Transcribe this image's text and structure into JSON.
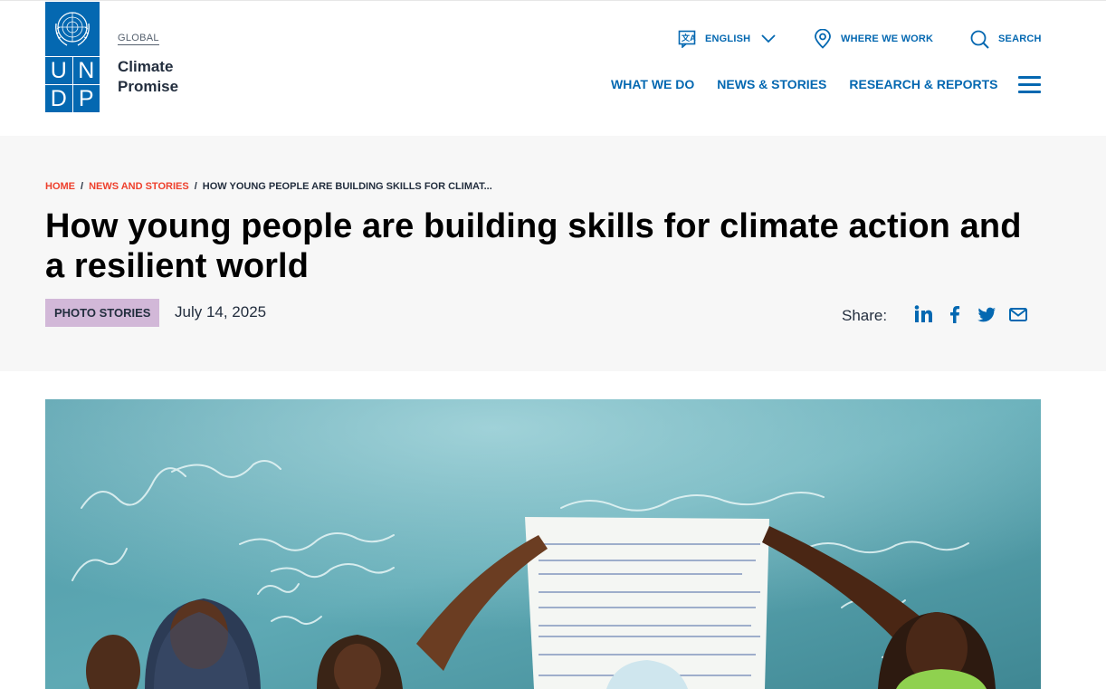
{
  "header": {
    "region": "GLOBAL",
    "site_name_line1": "Climate",
    "site_name_line2": "Promise",
    "logo_letters": [
      "U",
      "N",
      "D",
      "P"
    ],
    "utility": {
      "language": "ENGLISH",
      "where": "WHERE WE WORK",
      "search": "SEARCH"
    },
    "nav": [
      "WHAT WE DO",
      "NEWS & STORIES",
      "RESEARCH & REPORTS"
    ]
  },
  "breadcrumb": {
    "home": "HOME",
    "section": "NEWS AND STORIES",
    "current": "HOW YOUNG PEOPLE ARE BUILDING SKILLS FOR CLIMAT..."
  },
  "article": {
    "title": "How young people are building skills for climate action and a resilient world",
    "tag": "PHOTO STORIES",
    "date": "July 14, 2025",
    "share_label": "Share:"
  },
  "colors": {
    "brand_blue": "#0468b1",
    "breadcrumb_red": "#ee402d",
    "tag_purple": "#d2b8d8",
    "hero_bg": "#f7f7f7"
  }
}
